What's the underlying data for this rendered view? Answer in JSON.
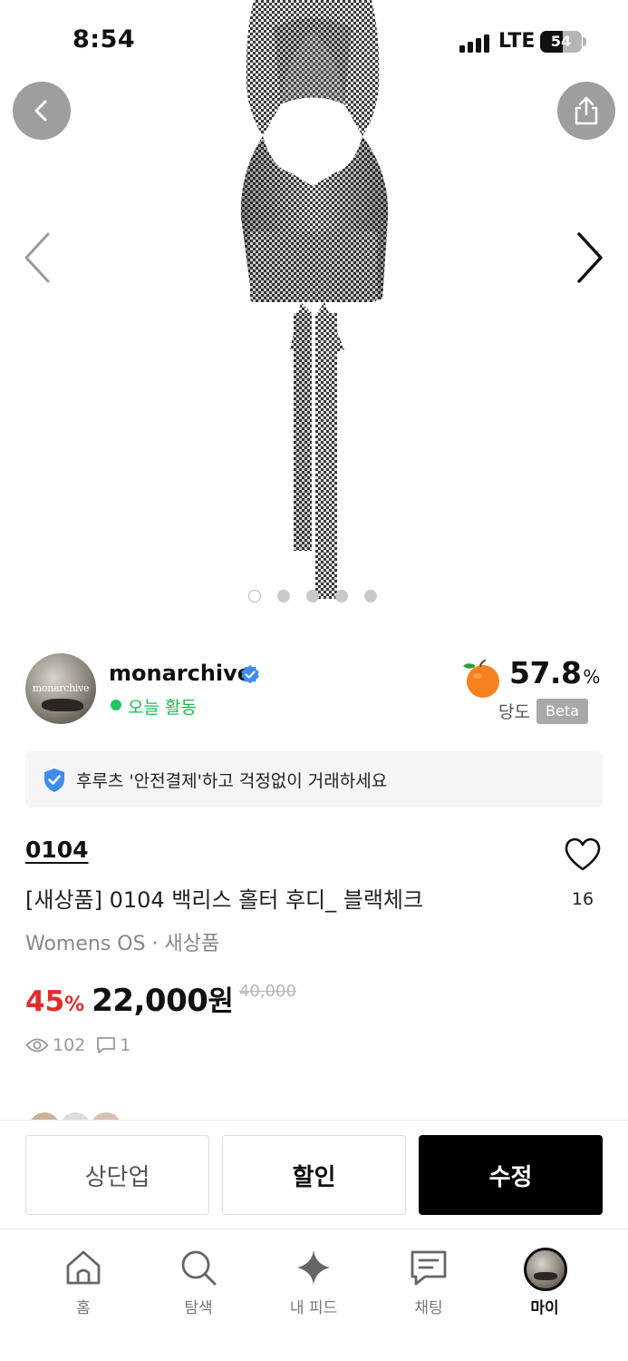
{
  "status_bar": {
    "time": "8:54",
    "network": "LTE",
    "battery_level": "54",
    "battery_fraction": 0.54
  },
  "hero": {
    "back_icon": "chevron-left-icon",
    "share_icon": "share-icon",
    "prev_icon": "chevron-left-icon",
    "next_icon": "chevron-right-icon",
    "image_count": 5,
    "active_image_index": 0
  },
  "seller": {
    "avatar_text": "monarchive",
    "name": "monarchive",
    "activity": "오늘 활동",
    "sweetness_value": "57.8",
    "sweetness_unit": "%",
    "sweetness_label": "당도",
    "beta_label": "Beta"
  },
  "safe_payment": {
    "text": "후루츠 '안전결제'하고 걱정없이 거래하세요"
  },
  "product": {
    "brand": "0104",
    "title": "[새상품] 0104 백리스 홀터 후디_ 블랙체크",
    "meta": "Womens OS · 새상품",
    "discount_value": "45",
    "discount_unit": "%",
    "price": "22,000",
    "price_unit": "원",
    "original_price": "40,000",
    "likes": "16",
    "views": "102",
    "comments": "1"
  },
  "actions": {
    "bump_label": "상단업",
    "discount_label": "할인",
    "edit_label": "수정"
  },
  "tabs": [
    {
      "label": "홈",
      "icon": "home-icon"
    },
    {
      "label": "탐색",
      "icon": "search-icon"
    },
    {
      "label": "내 피드",
      "icon": "sparkle-icon"
    },
    {
      "label": "채팅",
      "icon": "chat-icon"
    },
    {
      "label": "마이",
      "icon": "profile-avatar"
    }
  ],
  "colors": {
    "discount_red": "#e52a2a",
    "active_green": "#1db954",
    "verified_blue": "#3d8cf0",
    "fruit_orange": "#f5821f",
    "primary_button": "#000000"
  }
}
